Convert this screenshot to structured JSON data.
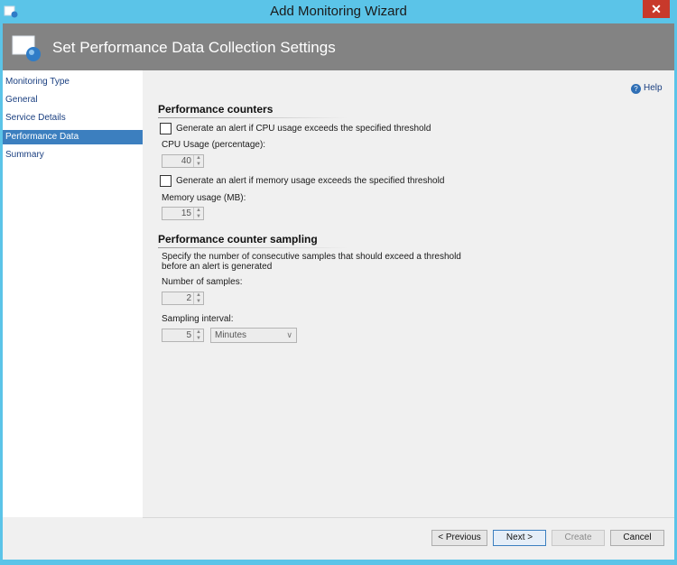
{
  "window": {
    "title": "Add Monitoring Wizard",
    "close_glyph": "✕"
  },
  "header": {
    "title": "Set Performance Data Collection Settings"
  },
  "nav": {
    "items": [
      {
        "label": "Monitoring Type",
        "active": false
      },
      {
        "label": "General",
        "active": false
      },
      {
        "label": "Service Details",
        "active": false
      },
      {
        "label": "Performance Data",
        "active": true
      },
      {
        "label": "Summary",
        "active": false
      }
    ]
  },
  "help": {
    "label": "Help",
    "icon": "?"
  },
  "counters": {
    "title": "Performance counters",
    "cpu_alert_label": "Generate an alert if CPU usage exceeds the specified threshold",
    "cpu_label": "CPU Usage (percentage):",
    "cpu_value": "40",
    "memory_alert_label": "Generate an alert if memory usage exceeds the specified threshold",
    "memory_label": "Memory usage (MB):",
    "memory_value": "15"
  },
  "sampling": {
    "title": "Performance counter sampling",
    "description_line1": "Specify the number of consecutive samples that should exceed a threshold",
    "description_line2": "before an alert is generated",
    "samples_label": "Number of samples:",
    "samples_value": "2",
    "interval_label": "Sampling interval:",
    "interval_value": "5",
    "interval_unit": "Minutes"
  },
  "buttons": {
    "previous": "< Previous",
    "next": "Next >",
    "create": "Create",
    "cancel": "Cancel"
  },
  "colors": {
    "titlebar": "#5bc4e8",
    "header": "#838383",
    "nav_active": "#3c7fbf",
    "close": "#c8392b"
  }
}
